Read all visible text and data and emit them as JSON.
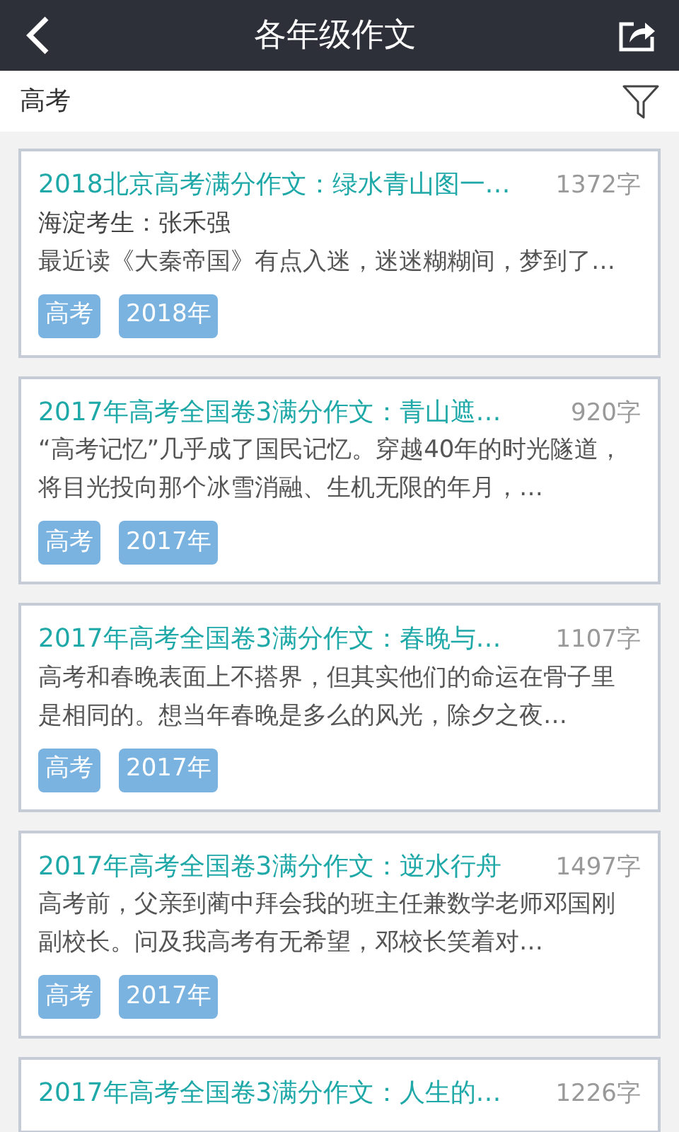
{
  "header": {
    "title": "各年级作文"
  },
  "filter": {
    "label": "高考"
  },
  "articles": [
    {
      "title": "2018北京高考满分作文：绿水青山图一…",
      "count": "1372字",
      "author": "海淀考生：张禾强",
      "excerpt": "最近读《大秦帝国》有点入迷，迷迷糊糊间，梦到了…",
      "tags": [
        "高考",
        "2018年"
      ]
    },
    {
      "title": "2017年高考全国卷3满分作文：青山遮…",
      "count": "920字",
      "excerpt": "“高考记忆”几乎成了国民记忆。穿越40年的时光隧道，将目光投向那个冰雪消融、生机无限的年月，…",
      "tags": [
        "高考",
        "2017年"
      ]
    },
    {
      "title": "2017年高考全国卷3满分作文：春晚与…",
      "count": "1107字",
      "excerpt": "高考和春晚表面上不搭界，但其实他们的命运在骨子里是相同的。想当年春晚是多么的风光，除夕之夜…",
      "tags": [
        "高考",
        "2017年"
      ]
    },
    {
      "title": "2017年高考全国卷3满分作文：逆水行舟",
      "count": "1497字",
      "excerpt": "高考前，父亲到蔺中拜会我的班主任兼数学老师邓国刚副校长。问及我高考有无希望，邓校长笑着对…",
      "tags": [
        "高考",
        "2017年"
      ]
    },
    {
      "title": "2017年高考全国卷3满分作文：人生的…",
      "count": "1226字"
    }
  ]
}
